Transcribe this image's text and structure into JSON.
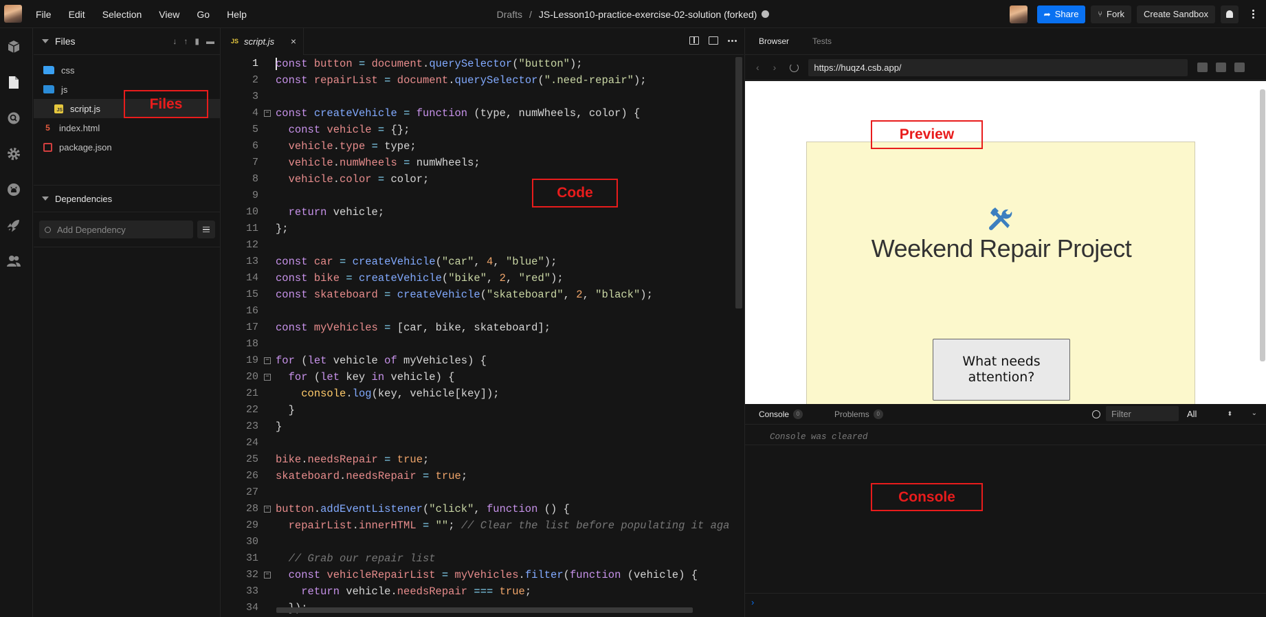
{
  "menu": [
    "File",
    "Edit",
    "Selection",
    "View",
    "Go",
    "Help"
  ],
  "title": {
    "drafts": "Drafts",
    "separator": "/",
    "name": "JS-Lesson10-practice-exercise-02-solution (forked)"
  },
  "topbar": {
    "share": "Share",
    "fork": "Fork",
    "create": "Create Sandbox"
  },
  "files": {
    "header": "Files",
    "items": [
      {
        "name": "css",
        "type": "folder"
      },
      {
        "name": "js",
        "type": "folder-open"
      },
      {
        "name": "script.js",
        "type": "js"
      },
      {
        "name": "index.html",
        "type": "html"
      },
      {
        "name": "package.json",
        "type": "json"
      }
    ]
  },
  "dependencies": {
    "header": "Dependencies",
    "placeholder": "Add Dependency"
  },
  "editor": {
    "tab": "script.js",
    "tab_type": "JS",
    "close": "×"
  },
  "browser": {
    "tabs": [
      "Browser",
      "Tests"
    ],
    "url": "https://huqz4.csb.app/",
    "page_title": "Weekend Repair Project",
    "button": "What needs attention?"
  },
  "console": {
    "tab": "Console",
    "console_count": "0",
    "problems": "Problems",
    "problems_count": "0",
    "filter_placeholder": "Filter",
    "level": "All",
    "message": "Console was cleared",
    "prompt": "›"
  },
  "annotations": {
    "files": "Files",
    "code": "Code",
    "preview": "Preview",
    "console": "Console"
  },
  "colors": {
    "accent": "#0971f1",
    "annotation": "#e81c1c",
    "preview_bg": "#fcf8cc"
  }
}
